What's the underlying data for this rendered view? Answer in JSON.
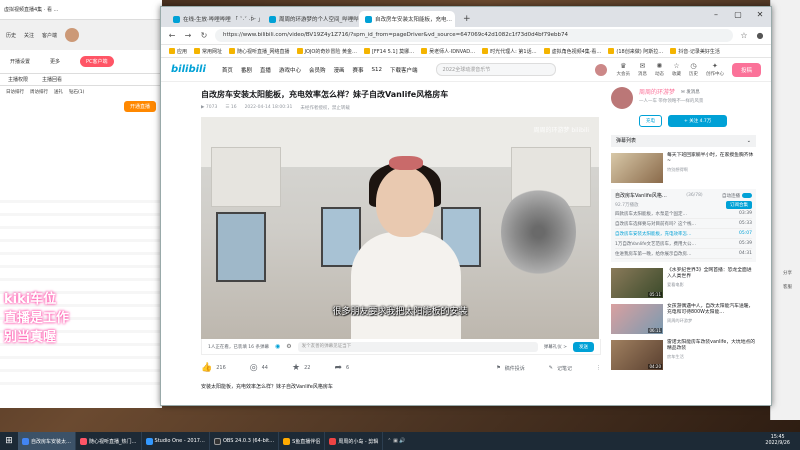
{
  "browser": {
    "tabs": [
      {
        "label": "在线-生放·哔哩哔哩 「 ˇ·ˇ ·ᐕ 」",
        "active": false
      },
      {
        "label": "周周的环游梦的个人空间_哔哩哔…",
        "active": false
      },
      {
        "label": "自改房车安装太阳能板，充电…",
        "active": true
      }
    ],
    "url": "https://www.bilibili.com/video/BV19Z4y1Z716/?spm_id_from=pageDriver&vd_source=647069c42d1082c1f73d0d4bf79ebb74",
    "bookmarks": [
      "应用",
      "常用网址",
      "随心视听直播_网络直播",
      "JOJO的奇妙冒险 黄金…",
      "[FF14 5.1] 莫娜…",
      "…",
      "吴老师人·IDNVAD…",
      "时光代理人: 第1话…",
      "虚拟角色视频4集·看…",
      "(18创来做) 阿斯拉…",
      "抖音·记录美好生活"
    ]
  },
  "bili": {
    "logo": "bilibili",
    "nav": [
      "首页",
      "番剧",
      "直播",
      "游戏中心",
      "会员购",
      "漫画",
      "赛事",
      "S12",
      "下载客户端"
    ],
    "search_placeholder": "2022全球动漫音乐节",
    "user_icons": [
      "大会员",
      "消息",
      "动态",
      "收藏",
      "历史",
      "创作中心"
    ],
    "upload_label": "投稿"
  },
  "video": {
    "title": "自改房车安装太阳能板，充电效率怎么样？妹子自改Vanlife风格房车",
    "views": "7073",
    "danmaku_count": "16",
    "date": "2022-04-14 18:00:31",
    "warning": "未经作者授权，禁止转载",
    "watermark": "周周的环游梦 bilibili",
    "subtitle": "很多朋友要求我把太阳能板的安装",
    "watching": "1人正在看，已装填 16 条弹幕",
    "danmu_placeholder": "发个友善的弹幕见证当下",
    "danmu_etiquette": "弹幕礼仪 >",
    "send_label": "发送",
    "likes": "216",
    "coins": "44",
    "favs": "22",
    "shares": "6",
    "report": "稿件投诉",
    "notes": "记笔记",
    "description": "安装太阳能板，充电效率怎么样？妹子自改Vanlife风格房车"
  },
  "uploader": {
    "name": "周周的环游梦",
    "message_label": "发消息",
    "bio": "一人一车 带你领略不一样的风景",
    "charge_label": "充电",
    "follow_label": "+ 关注 4.7万"
  },
  "sidebar": {
    "danmaku_list": "弹幕列表",
    "rec_top": {
      "title": "每天下班回家躺半小时，在家摸鱼胸齐休~",
      "author": "特别想得啊"
    },
    "playlist_title": "自改房车Vanlife风格…",
    "playlist_progress": "(36/78)",
    "playlist_views": "92.7万播放",
    "playlist_count": "订阅合集",
    "autoplay": "自动连播",
    "playlist_items": [
      {
        "title": "四款房车太阳能板，水泵是个固定…",
        "time": "03:39",
        "current": false
      },
      {
        "title": "自改房车选择要与对目前有吗？这个栈…",
        "time": "05:33",
        "current": false
      },
      {
        "title": "自改房车安装太阳能板，充电效率怎…",
        "time": "05:07",
        "current": true
      },
      {
        "title": "1万自改Vanlife文艺范房车，费用大公…",
        "time": "05:39",
        "current": false
      },
      {
        "title": "住进我房车第一晚，给你展示自改房…",
        "time": "04:31",
        "current": false
      }
    ],
    "recs": [
      {
        "title": "《水罗纪世界3》全网首播：恐龙全面进入人类世界",
        "author": "爱看电影",
        "dur": "05:11"
      },
      {
        "title": "女孩游偶遇中人，自改太阳能汽车送暖，充电和可待800W太阳能…",
        "author": "周周的环游梦",
        "dur": "06:11"
      },
      {
        "title": "雷诺太阳能房车改装vanlife，大坑地点的精品改装",
        "author": "房车生活",
        "dur": "04:20"
      }
    ]
  },
  "rightrail": [
    "分享",
    "客服"
  ],
  "background_app": {
    "rows": [
      "历史",
      "关注",
      "客户端",
      "开播设置",
      "更多",
      "主播权限",
      "主播回看",
      "日访排行",
      "周访排行",
      "送礼",
      "钻石(1)"
    ],
    "overlay_line1": "kiki车位",
    "overlay_line2": "直播是工作",
    "overlay_line3": "别当真喔",
    "pc_badge": "PC客户端",
    "open_live": "开通直播"
  },
  "taskbar": {
    "items": [
      "自改房车安装太…",
      "随心视听直播_热门…",
      "Studio One - 2017…",
      "OBS 24.0.3 (64-bit…",
      "S鱼直播伴侣",
      "周周的小岛 - 剪辑"
    ],
    "time": "15:45",
    "date": "2022/9/26"
  },
  "colors": {
    "bili_blue": "#00a1d6",
    "bili_pink": "#fb7299"
  }
}
